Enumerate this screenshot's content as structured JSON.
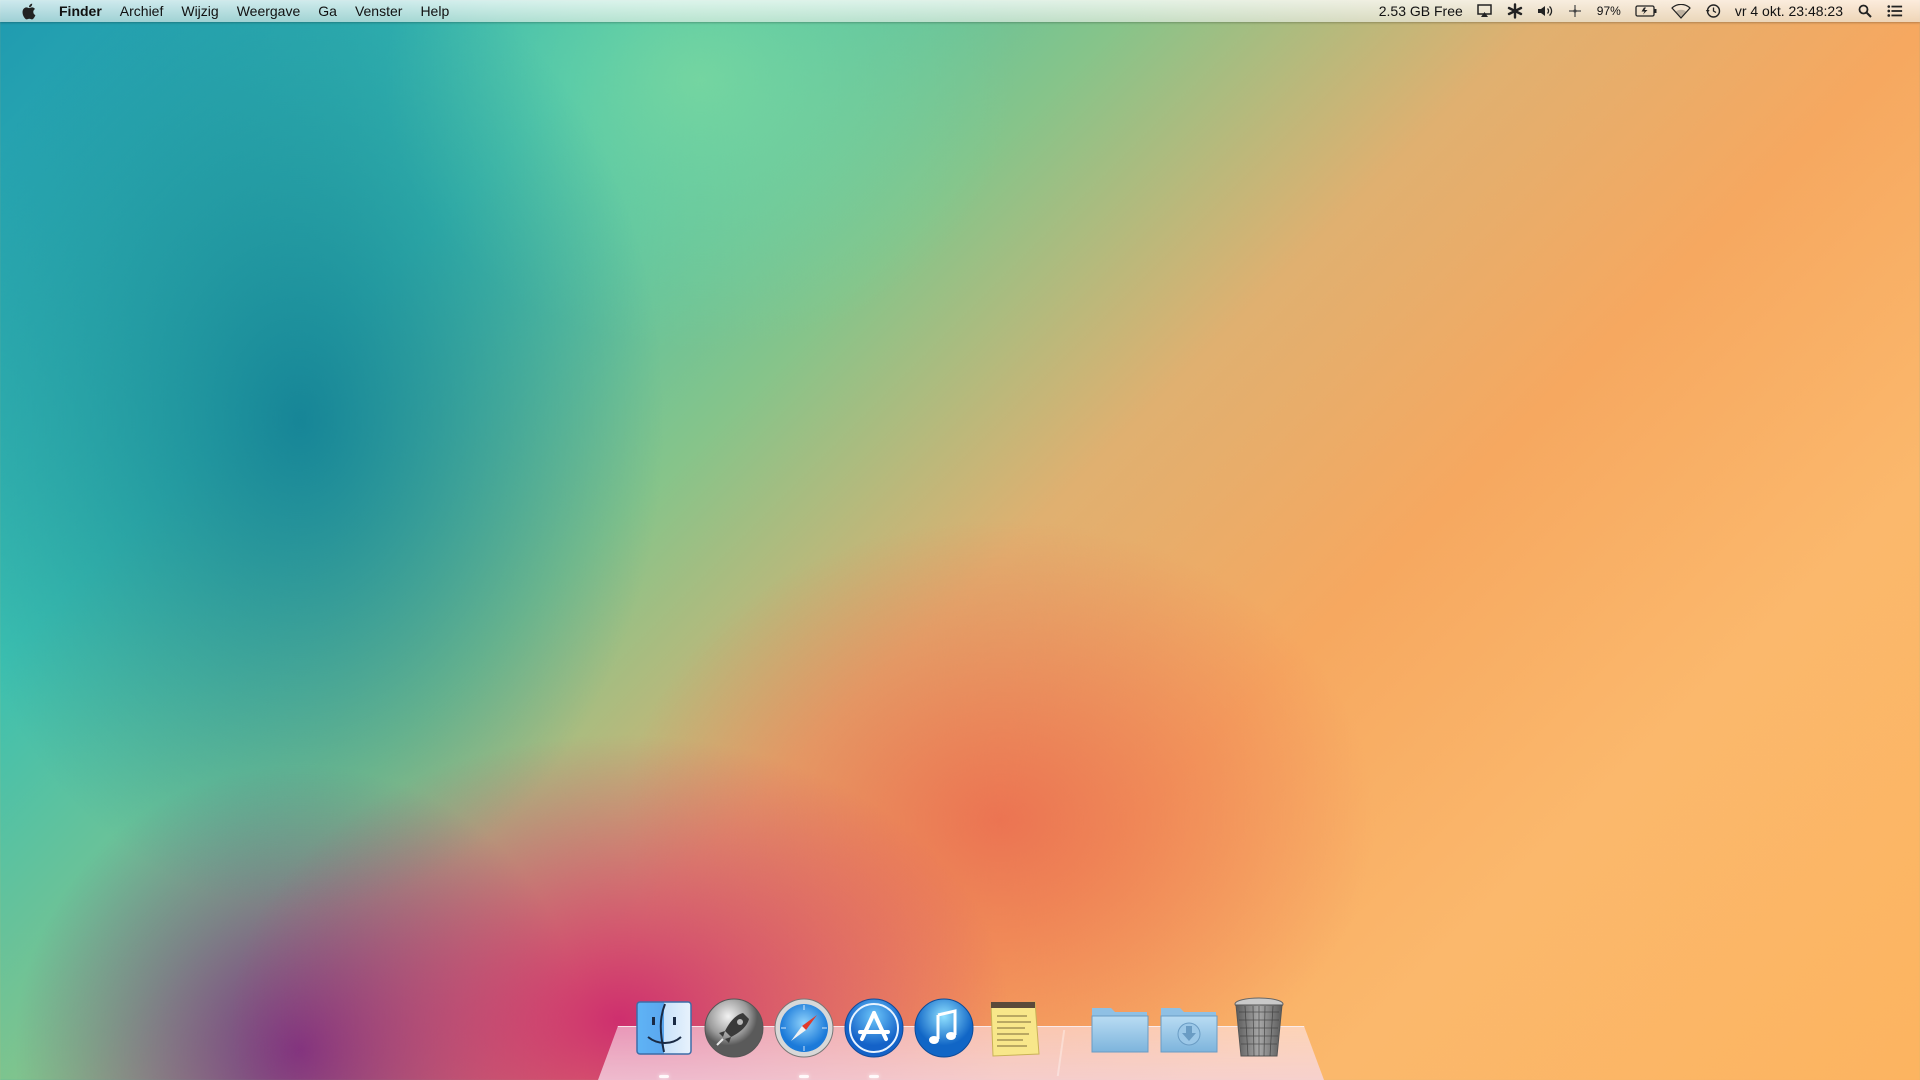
{
  "menubar": {
    "apple_icon": "apple-logo-icon",
    "items": [
      {
        "label": "Finder"
      },
      {
        "label": "Archief"
      },
      {
        "label": "Wijzig"
      },
      {
        "label": "Weergave"
      },
      {
        "label": "Ga"
      },
      {
        "label": "Venster"
      },
      {
        "label": "Help"
      }
    ],
    "status": {
      "disk_free": "2.53 GB Free",
      "battery_percent": "97%",
      "clock": "vr 4 okt.  23:48:23"
    }
  },
  "dock": {
    "apps": [
      {
        "name": "finder-icon"
      },
      {
        "name": "launchpad-icon"
      },
      {
        "name": "safari-icon"
      },
      {
        "name": "app-store-icon"
      },
      {
        "name": "itunes-icon"
      },
      {
        "name": "notes-icon"
      },
      {
        "name": "folder-icon"
      },
      {
        "name": "downloads-folder-icon"
      },
      {
        "name": "trash-icon"
      }
    ]
  }
}
